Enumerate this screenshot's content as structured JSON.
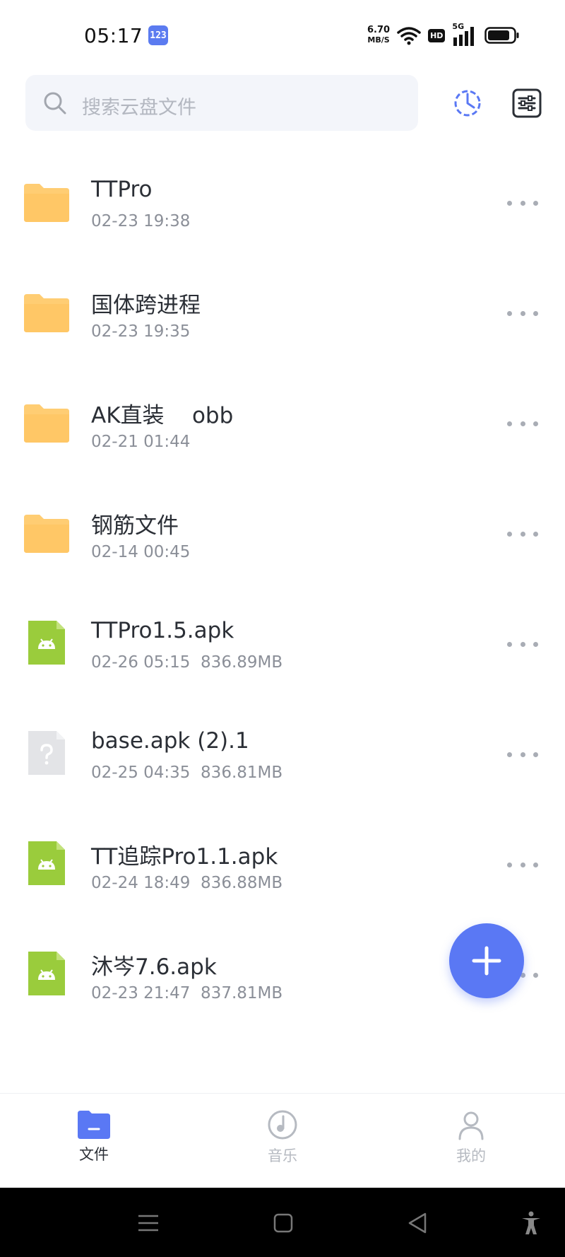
{
  "status_bar": {
    "time": "05:17",
    "app_badge": "123",
    "net_speed_value": "6.70",
    "net_speed_unit": "MB/S",
    "hd_label": "HD",
    "network_type": "5G"
  },
  "header": {
    "search_placeholder": "搜索云盘文件"
  },
  "files": [
    {
      "name": "TTPro",
      "meta": "02-23 19:38",
      "type": "folder"
    },
    {
      "name": "国体跨进程",
      "meta": "02-23 19:35",
      "type": "folder"
    },
    {
      "name": "AK直装    obb",
      "meta": "02-21 01:44",
      "type": "folder"
    },
    {
      "name": "钢筋文件",
      "meta": "02-14 00:45",
      "type": "folder"
    },
    {
      "name": "TTPro1.5.apk",
      "meta": "02-26 05:15  836.89MB",
      "type": "apk"
    },
    {
      "name": "base.apk (2).1",
      "meta": "02-25 04:35  836.81MB",
      "type": "unknown"
    },
    {
      "name": "TT追踪Pro1.1.apk",
      "meta": "02-24 18:49  836.88MB",
      "type": "apk"
    },
    {
      "name": "沐岑7.6.apk",
      "meta": "02-23 21:47  837.81MB",
      "type": "apk"
    }
  ],
  "bottom_nav": {
    "files": "文件",
    "music": "音乐",
    "mine": "我的"
  },
  "colors": {
    "accent": "#5a78f4",
    "folder": "#ffcd73",
    "apk": "#9acc3c",
    "unknown": "#e3e4e7",
    "inactive_nav": "#b6bac1",
    "active_nav": "#2b2f36"
  },
  "icons": {
    "search": "search-icon",
    "transfer": "transfer-icon",
    "sort": "sort-icon",
    "add": "plus-icon"
  }
}
